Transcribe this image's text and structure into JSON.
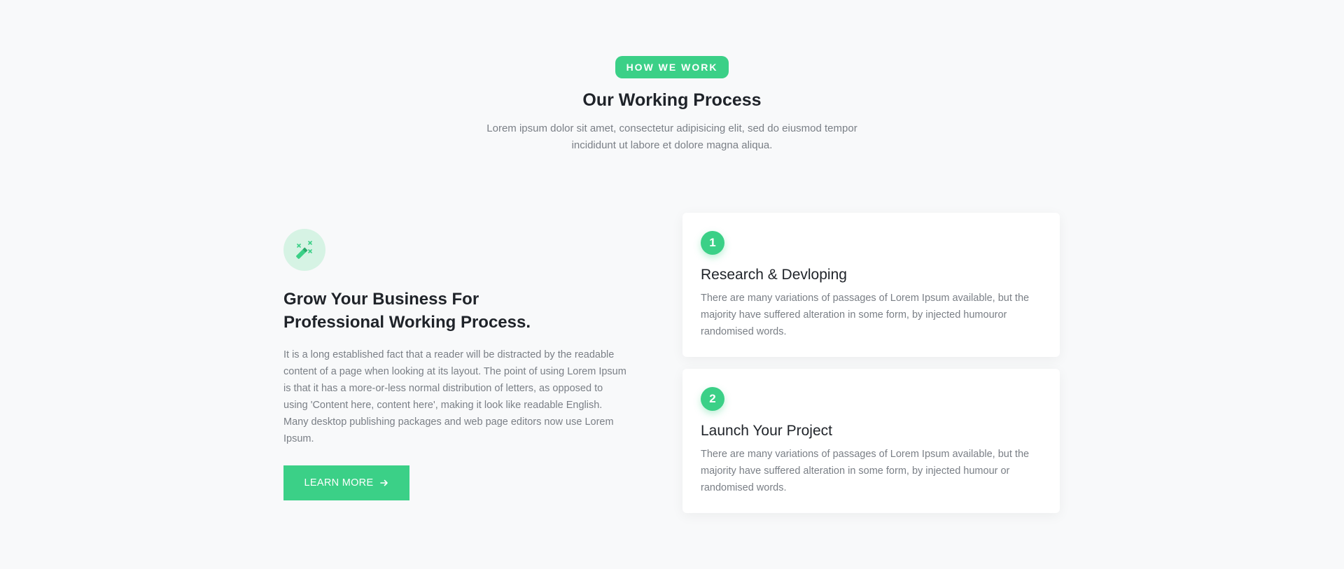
{
  "header": {
    "badge": "HOW WE WORK",
    "title": "Our Working Process",
    "description": "Lorem ipsum dolor sit amet, consectetur adipisicing elit, sed do eiusmod tempor incididunt ut labore et dolore magna aliqua."
  },
  "feature": {
    "icon": "magic-wand-icon",
    "title": "Grow Your Business For Professional Working Process.",
    "text": "It is a long established fact that a reader will be distracted by the readable content of a page when looking at its layout. The point of using Lorem Ipsum is that it has a more-or-less normal distribution of letters, as opposed to using 'Content here, content here', making it look like readable English. Many desktop publishing packages and web page editors now use Lorem Ipsum.",
    "button_label": "LEARN MORE",
    "button_icon": "arrow-right-icon"
  },
  "steps": [
    {
      "number": "1",
      "title": "Research & Devloping",
      "text": "There are many variations of passages of Lorem Ipsum available, but the majority have suffered alteration in some form, by injected humouror randomised words."
    },
    {
      "number": "2",
      "title": "Launch Your Project",
      "text": "There are many variations of passages of Lorem Ipsum available, but the majority have suffered alteration in some form, by injected humour or randomised words."
    }
  ],
  "colors": {
    "accent": "#3bd087",
    "accent_light": "#d6f3e4",
    "background": "#f8f9fa",
    "heading": "#1f2329",
    "body_text": "#7a7f86"
  }
}
